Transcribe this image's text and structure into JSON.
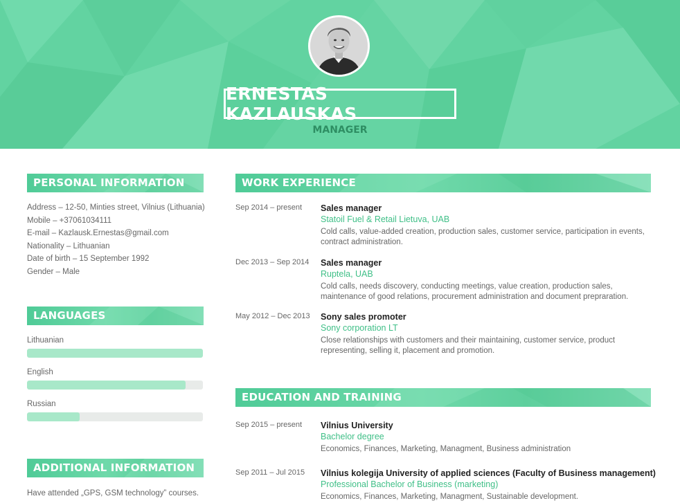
{
  "header": {
    "name": "ERNESTAS KAZLAUSKAS",
    "role": "MANAGER"
  },
  "colors": {
    "accent": "#62d3a1",
    "accent_dark": "#2e8e63",
    "org_text": "#3fbf87",
    "bar_fill": "#a8e8c9",
    "bar_track": "#e8ebe9"
  },
  "personal": {
    "heading": "PERSONAL INFORMATION",
    "lines": [
      "Address – 12-50, Minties street, Vilnius (Lithuania)",
      "Mobile – +37061034111",
      "E-mail – Kazlausk.Ernestas@gmail.com",
      "Nationality – Lithuanian",
      "Date of birth – 15 September 1992",
      "Gender – Male"
    ]
  },
  "languages": {
    "heading": "LANGUAGES",
    "items": [
      {
        "name": "Lithuanian",
        "level": 1.0
      },
      {
        "name": "English",
        "level": 0.9
      },
      {
        "name": "Russian",
        "level": 0.3
      }
    ]
  },
  "additional": {
    "heading": "ADDITIONAL INFORMATION",
    "text": "Have attended „GPS, GSM technology” courses."
  },
  "work": {
    "heading": "WORK EXPERIENCE",
    "entries": [
      {
        "date": "Sep 2014 – present",
        "title": "Sales manager",
        "org": "Statoil Fuel & Retail Lietuva, UAB",
        "desc": "Cold calls, value-added creation, production sales, customer service, participation in events, contract administration."
      },
      {
        "date": "Dec 2013 – Sep 2014",
        "title": "Sales manager",
        "org": "Ruptela, UAB",
        "desc": "Cold calls, needs discovery, conducting meetings, value creation, production sales, maintenance of good relations, procurement administration and document prepraration."
      },
      {
        "date": "May 2012 – Dec 2013",
        "title": "Sony sales promoter",
        "org": "Sony corporation LT",
        "desc": "Close relationships with customers and their maintaining, customer service, product representing, selling it, placement and promotion."
      }
    ]
  },
  "education": {
    "heading": "EDUCATION AND TRAINING",
    "entries": [
      {
        "date": "Sep 2015 – present",
        "title": "Vilnius University",
        "org": "Bachelor degree",
        "desc": "Economics, Finances, Marketing, Managment, Business administration"
      },
      {
        "date": "Sep 2011 – Jul 2015",
        "title": "Vilnius kolegija University of applied sciences (Faculty of Business management)",
        "org": "Professional Bachelor of Business (marketing)",
        "desc": "Economics, Finances, Marketing, Managment, Sustainable development."
      }
    ]
  }
}
